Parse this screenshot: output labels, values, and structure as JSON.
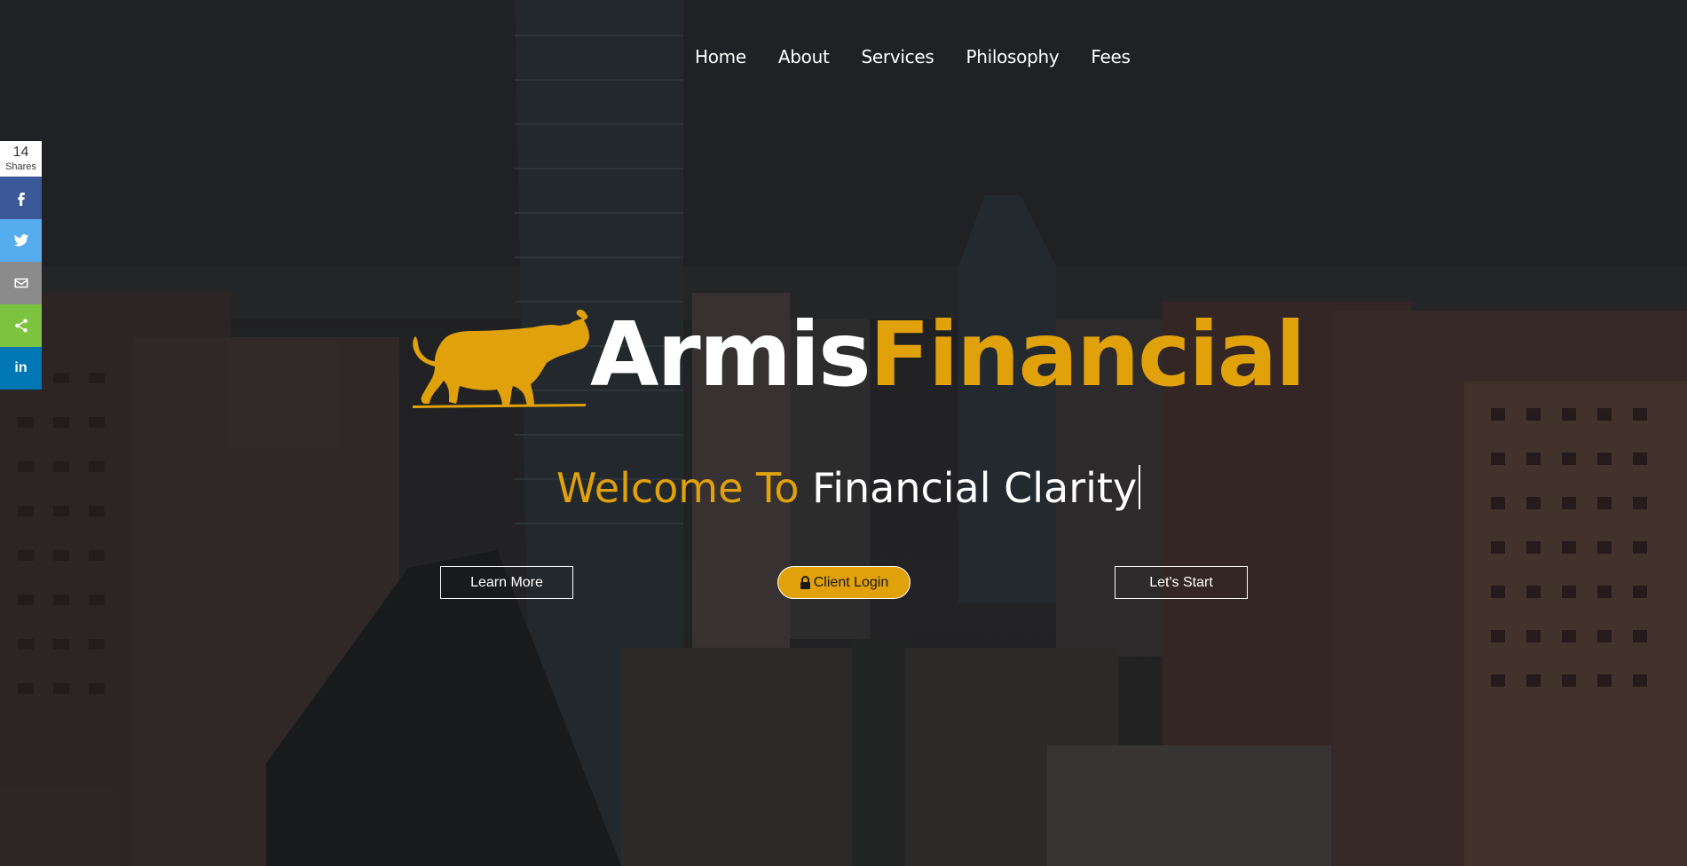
{
  "nav": {
    "items": [
      {
        "label": "Home"
      },
      {
        "label": "About"
      },
      {
        "label": "Services"
      },
      {
        "label": "Philosophy"
      },
      {
        "label": "Fees"
      }
    ]
  },
  "share": {
    "count": "14",
    "count_label": "Shares",
    "buttons": [
      {
        "icon": "facebook-icon"
      },
      {
        "icon": "twitter-icon"
      },
      {
        "icon": "email-icon"
      },
      {
        "icon": "share-icon"
      },
      {
        "icon": "linkedin-icon",
        "label": "in"
      }
    ]
  },
  "logo": {
    "part1": "Armis",
    "part2": "Financial",
    "icon": "bull-icon"
  },
  "headline": {
    "gold": "Welcome To",
    "white": "Financial Clarity"
  },
  "buttons": {
    "learn_more": "Learn More",
    "client_login": "Client Login",
    "lets_start": "Let's Start"
  },
  "colors": {
    "accent": "#e0a10a",
    "facebook": "#3b5998",
    "twitter": "#55acee",
    "email": "#8b8b8b",
    "share": "#7cc33f",
    "linkedin": "#0077b5"
  }
}
